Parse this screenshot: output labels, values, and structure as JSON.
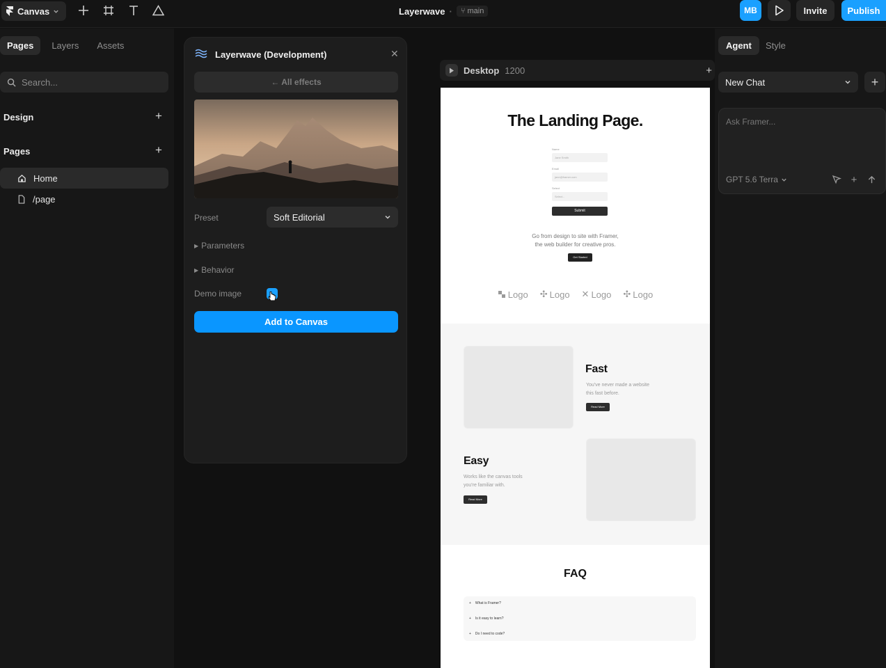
{
  "topbar": {
    "canvas_label": "Canvas",
    "project_title": "Layerwave",
    "branch": "main",
    "avatar_initials": "MB",
    "invite_label": "Invite",
    "publish_label": "Publish",
    "accent": "#1aa0ff"
  },
  "left": {
    "tabs": [
      "Pages",
      "Layers",
      "Assets"
    ],
    "search_placeholder": "Search...",
    "design_label": "Design",
    "pages_label": "Pages",
    "pages": [
      "Home",
      "/page"
    ]
  },
  "plugin": {
    "title": "Layerwave (Development)",
    "all_effects": "← All effects",
    "preset_label": "Preset",
    "preset_value": "Soft Editorial",
    "parameters_label": "Parameters",
    "behavior_label": "Behavior",
    "demo_image_label": "Demo image",
    "add_button": "Add to Canvas"
  },
  "frame": {
    "label": "Desktop",
    "width": "1200"
  },
  "site": {
    "hero_title": "The Landing Page.",
    "form": {
      "name_label": "Name",
      "name_placeholder": "Jane Smith",
      "email_label": "Email",
      "email_placeholder": "jane@framer.com",
      "select_label": "Select",
      "select_placeholder": "Select...",
      "submit": "Submit"
    },
    "hero_sub_1": "Go from design to site with Framer,",
    "hero_sub_2": "the web builder for creative pros.",
    "get_started": "Get Started",
    "logos": [
      "Logo",
      "Logo",
      "Logo",
      "Logo"
    ],
    "fast_title": "Fast",
    "fast_text": "You've never made a website this fast before.",
    "fast_btn": "Read More",
    "easy_title": "Easy",
    "easy_text": "Works like the canvas tools you're familiar with.",
    "easy_btn": "Read More",
    "faq_title": "FAQ",
    "faq": [
      "What is Framer?",
      "Is it easy to learn?",
      "Do I need to code?"
    ]
  },
  "right": {
    "tabs": [
      "Agent",
      "Style"
    ],
    "chat_select": "New Chat",
    "ask_placeholder": "Ask Framer...",
    "model": "GPT 5.6 Terra"
  }
}
